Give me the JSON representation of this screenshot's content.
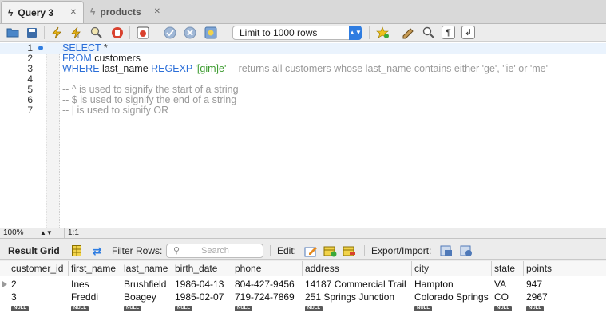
{
  "tabs": [
    {
      "label": "Query 3",
      "active": true
    },
    {
      "label": "products",
      "active": false
    }
  ],
  "toolbar": {
    "limit_label": "Limit to 1000 rows",
    "icons": [
      "folder-icon",
      "save-icon",
      "execute-icon",
      "execute-current-icon",
      "explain-icon",
      "stop-icon",
      "stop-on-error-icon",
      "commit-icon",
      "rollback-icon",
      "autocommit-icon",
      "bookmark-icon",
      "beautify-icon",
      "find-icon",
      "invisible-chars-icon",
      "wrap-icon"
    ]
  },
  "editor": {
    "lines": [
      {
        "num": "1",
        "bullet": true,
        "tokens": [
          {
            "t": "SELECT",
            "c": "kw"
          },
          {
            "t": " *",
            "c": "txt"
          }
        ]
      },
      {
        "num": "2",
        "bullet": false,
        "tokens": [
          {
            "t": "FROM",
            "c": "kw"
          },
          {
            "t": " customers",
            "c": "txt"
          }
        ]
      },
      {
        "num": "3",
        "bullet": false,
        "tokens": [
          {
            "t": "WHERE",
            "c": "kw"
          },
          {
            "t": " last_name ",
            "c": "txt"
          },
          {
            "t": "REGEXP",
            "c": "kw"
          },
          {
            "t": " ",
            "c": "txt"
          },
          {
            "t": "'[gim]e'",
            "c": "str"
          },
          {
            "t": " -- returns all customers whose last_name contains either 'ge', \"ie' or 'me'",
            "c": "cmt"
          }
        ]
      },
      {
        "num": "4",
        "bullet": false,
        "tokens": []
      },
      {
        "num": "5",
        "bullet": false,
        "tokens": [
          {
            "t": "-- ^ is used to signify the start of a string",
            "c": "cmt"
          }
        ]
      },
      {
        "num": "6",
        "bullet": false,
        "tokens": [
          {
            "t": "-- $ is used to signify the end of a string",
            "c": "cmt"
          }
        ]
      },
      {
        "num": "7",
        "bullet": false,
        "tokens": [
          {
            "t": "-- | is used to signify OR",
            "c": "cmt"
          }
        ]
      }
    ]
  },
  "status": {
    "zoom": "100%",
    "position": "1:1"
  },
  "result_toolbar": {
    "result_grid": "Result Grid",
    "filter_rows": "Filter Rows:",
    "search_placeholder": "Search",
    "edit": "Edit:",
    "export_import": "Export/Import:"
  },
  "grid": {
    "columns": [
      "customer_id",
      "first_name",
      "last_name",
      "birth_date",
      "phone",
      "address",
      "city",
      "state",
      "points"
    ],
    "rows": [
      [
        "2",
        "Ines",
        "Brushfield",
        "1986-04-13",
        "804-427-9456",
        "14187 Commercial Trail",
        "Hampton",
        "VA",
        "947"
      ],
      [
        "3",
        "Freddi",
        "Boagey",
        "1985-02-07",
        "719-724-7869",
        "251 Springs Junction",
        "Colorado Springs",
        "CO",
        "2967"
      ]
    ],
    "null_label": "NULL"
  },
  "colors": {
    "accent": "#2f7de1",
    "keyword": "#2c6fd8",
    "string": "#3b9b2e",
    "comment": "#9a9a9a"
  }
}
